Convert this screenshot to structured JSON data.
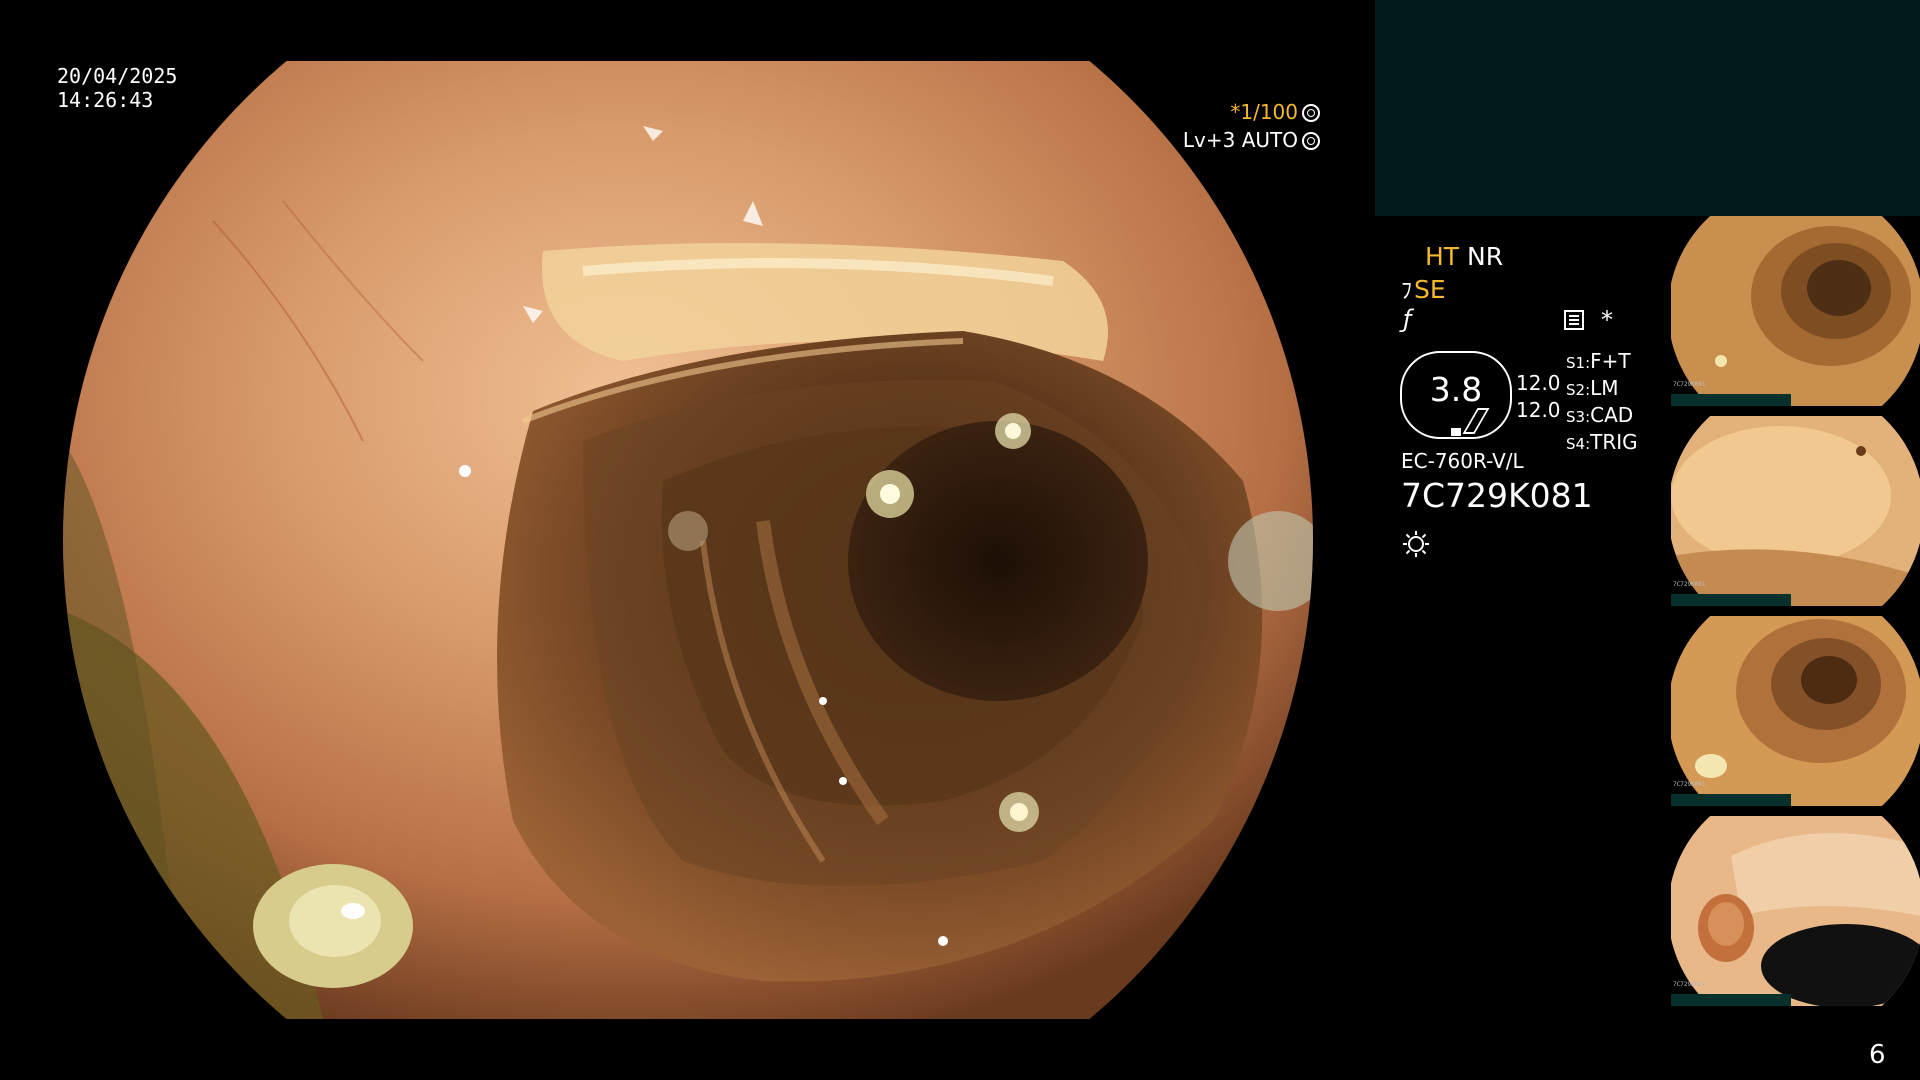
{
  "overlay": {
    "date": "20/04/2025",
    "time": "14:26:43",
    "shutter": "*1/100",
    "level": "Lv+3 AUTO"
  },
  "panel": {
    "mode_ht": "HT",
    "mode_nr": "NR",
    "se_label": "SE",
    "se_glyph": "ﾌ",
    "f_glyph": "ƒ",
    "capture_mark": "*",
    "zoom_value": "3.8",
    "gauge_values": [
      "12.0",
      "12.0"
    ],
    "switches": [
      {
        "key": "S1:",
        "value": "F+T"
      },
      {
        "key": "S2:",
        "value": "LM"
      },
      {
        "key": "S3:",
        "value": "CAD"
      },
      {
        "key": "S4:",
        "value": "TRIG"
      }
    ],
    "scope_model": "EC-760R-V/L",
    "scope_serial": "7C729K081"
  },
  "thumbnails": [
    {
      "label": "7C729K081"
    },
    {
      "label": "7C729K081"
    },
    {
      "label": "7C729K081"
    },
    {
      "label": "7C729K081"
    }
  ],
  "page_number": "6",
  "colors": {
    "accent": "#f5b830",
    "panel_bg": "#031a1a"
  }
}
